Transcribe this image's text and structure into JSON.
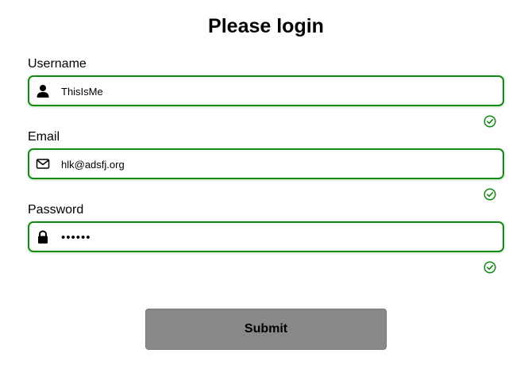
{
  "form": {
    "title": "Please login",
    "fields": [
      {
        "label": "Username",
        "value": "ThisIsMe",
        "icon": "user-icon",
        "valid": true
      },
      {
        "label": "Email",
        "value": "hlk@adsfj.org",
        "icon": "envelope-icon",
        "valid": true
      },
      {
        "label": "Password",
        "value": "••••••",
        "icon": "lock-icon",
        "valid": true
      }
    ],
    "submit_label": "Submit"
  },
  "colors": {
    "valid_border": "#138a13",
    "button_bg": "#868889",
    "text": "#000000"
  }
}
